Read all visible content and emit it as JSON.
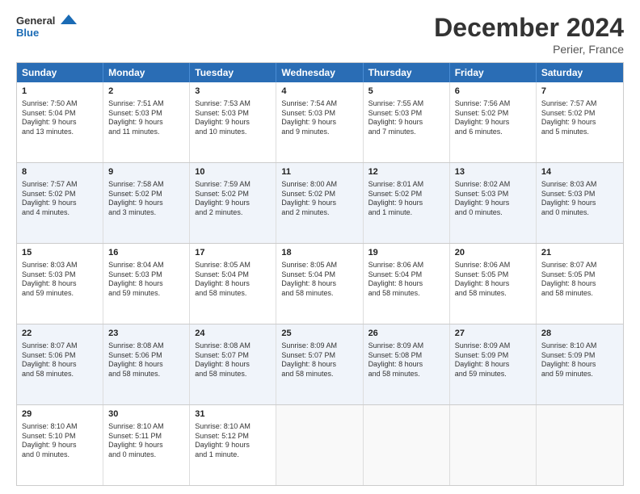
{
  "logo": {
    "line1": "General",
    "line2": "Blue"
  },
  "title": "December 2024",
  "location": "Perier, France",
  "header_days": [
    "Sunday",
    "Monday",
    "Tuesday",
    "Wednesday",
    "Thursday",
    "Friday",
    "Saturday"
  ],
  "rows": [
    [
      {
        "day": "1",
        "lines": [
          "Sunrise: 7:50 AM",
          "Sunset: 5:04 PM",
          "Daylight: 9 hours",
          "and 13 minutes."
        ]
      },
      {
        "day": "2",
        "lines": [
          "Sunrise: 7:51 AM",
          "Sunset: 5:03 PM",
          "Daylight: 9 hours",
          "and 11 minutes."
        ]
      },
      {
        "day": "3",
        "lines": [
          "Sunrise: 7:53 AM",
          "Sunset: 5:03 PM",
          "Daylight: 9 hours",
          "and 10 minutes."
        ]
      },
      {
        "day": "4",
        "lines": [
          "Sunrise: 7:54 AM",
          "Sunset: 5:03 PM",
          "Daylight: 9 hours",
          "and 9 minutes."
        ]
      },
      {
        "day": "5",
        "lines": [
          "Sunrise: 7:55 AM",
          "Sunset: 5:03 PM",
          "Daylight: 9 hours",
          "and 7 minutes."
        ]
      },
      {
        "day": "6",
        "lines": [
          "Sunrise: 7:56 AM",
          "Sunset: 5:02 PM",
          "Daylight: 9 hours",
          "and 6 minutes."
        ]
      },
      {
        "day": "7",
        "lines": [
          "Sunrise: 7:57 AM",
          "Sunset: 5:02 PM",
          "Daylight: 9 hours",
          "and 5 minutes."
        ]
      }
    ],
    [
      {
        "day": "8",
        "lines": [
          "Sunrise: 7:57 AM",
          "Sunset: 5:02 PM",
          "Daylight: 9 hours",
          "and 4 minutes."
        ]
      },
      {
        "day": "9",
        "lines": [
          "Sunrise: 7:58 AM",
          "Sunset: 5:02 PM",
          "Daylight: 9 hours",
          "and 3 minutes."
        ]
      },
      {
        "day": "10",
        "lines": [
          "Sunrise: 7:59 AM",
          "Sunset: 5:02 PM",
          "Daylight: 9 hours",
          "and 2 minutes."
        ]
      },
      {
        "day": "11",
        "lines": [
          "Sunrise: 8:00 AM",
          "Sunset: 5:02 PM",
          "Daylight: 9 hours",
          "and 2 minutes."
        ]
      },
      {
        "day": "12",
        "lines": [
          "Sunrise: 8:01 AM",
          "Sunset: 5:02 PM",
          "Daylight: 9 hours",
          "and 1 minute."
        ]
      },
      {
        "day": "13",
        "lines": [
          "Sunrise: 8:02 AM",
          "Sunset: 5:03 PM",
          "Daylight: 9 hours",
          "and 0 minutes."
        ]
      },
      {
        "day": "14",
        "lines": [
          "Sunrise: 8:03 AM",
          "Sunset: 5:03 PM",
          "Daylight: 9 hours",
          "and 0 minutes."
        ]
      }
    ],
    [
      {
        "day": "15",
        "lines": [
          "Sunrise: 8:03 AM",
          "Sunset: 5:03 PM",
          "Daylight: 8 hours",
          "and 59 minutes."
        ]
      },
      {
        "day": "16",
        "lines": [
          "Sunrise: 8:04 AM",
          "Sunset: 5:03 PM",
          "Daylight: 8 hours",
          "and 59 minutes."
        ]
      },
      {
        "day": "17",
        "lines": [
          "Sunrise: 8:05 AM",
          "Sunset: 5:04 PM",
          "Daylight: 8 hours",
          "and 58 minutes."
        ]
      },
      {
        "day": "18",
        "lines": [
          "Sunrise: 8:05 AM",
          "Sunset: 5:04 PM",
          "Daylight: 8 hours",
          "and 58 minutes."
        ]
      },
      {
        "day": "19",
        "lines": [
          "Sunrise: 8:06 AM",
          "Sunset: 5:04 PM",
          "Daylight: 8 hours",
          "and 58 minutes."
        ]
      },
      {
        "day": "20",
        "lines": [
          "Sunrise: 8:06 AM",
          "Sunset: 5:05 PM",
          "Daylight: 8 hours",
          "and 58 minutes."
        ]
      },
      {
        "day": "21",
        "lines": [
          "Sunrise: 8:07 AM",
          "Sunset: 5:05 PM",
          "Daylight: 8 hours",
          "and 58 minutes."
        ]
      }
    ],
    [
      {
        "day": "22",
        "lines": [
          "Sunrise: 8:07 AM",
          "Sunset: 5:06 PM",
          "Daylight: 8 hours",
          "and 58 minutes."
        ]
      },
      {
        "day": "23",
        "lines": [
          "Sunrise: 8:08 AM",
          "Sunset: 5:06 PM",
          "Daylight: 8 hours",
          "and 58 minutes."
        ]
      },
      {
        "day": "24",
        "lines": [
          "Sunrise: 8:08 AM",
          "Sunset: 5:07 PM",
          "Daylight: 8 hours",
          "and 58 minutes."
        ]
      },
      {
        "day": "25",
        "lines": [
          "Sunrise: 8:09 AM",
          "Sunset: 5:07 PM",
          "Daylight: 8 hours",
          "and 58 minutes."
        ]
      },
      {
        "day": "26",
        "lines": [
          "Sunrise: 8:09 AM",
          "Sunset: 5:08 PM",
          "Daylight: 8 hours",
          "and 58 minutes."
        ]
      },
      {
        "day": "27",
        "lines": [
          "Sunrise: 8:09 AM",
          "Sunset: 5:09 PM",
          "Daylight: 8 hours",
          "and 59 minutes."
        ]
      },
      {
        "day": "28",
        "lines": [
          "Sunrise: 8:10 AM",
          "Sunset: 5:09 PM",
          "Daylight: 8 hours",
          "and 59 minutes."
        ]
      }
    ],
    [
      {
        "day": "29",
        "lines": [
          "Sunrise: 8:10 AM",
          "Sunset: 5:10 PM",
          "Daylight: 9 hours",
          "and 0 minutes."
        ]
      },
      {
        "day": "30",
        "lines": [
          "Sunrise: 8:10 AM",
          "Sunset: 5:11 PM",
          "Daylight: 9 hours",
          "and 0 minutes."
        ]
      },
      {
        "day": "31",
        "lines": [
          "Sunrise: 8:10 AM",
          "Sunset: 5:12 PM",
          "Daylight: 9 hours",
          "and 1 minute."
        ]
      },
      {
        "day": "",
        "lines": []
      },
      {
        "day": "",
        "lines": []
      },
      {
        "day": "",
        "lines": []
      },
      {
        "day": "",
        "lines": []
      }
    ]
  ]
}
